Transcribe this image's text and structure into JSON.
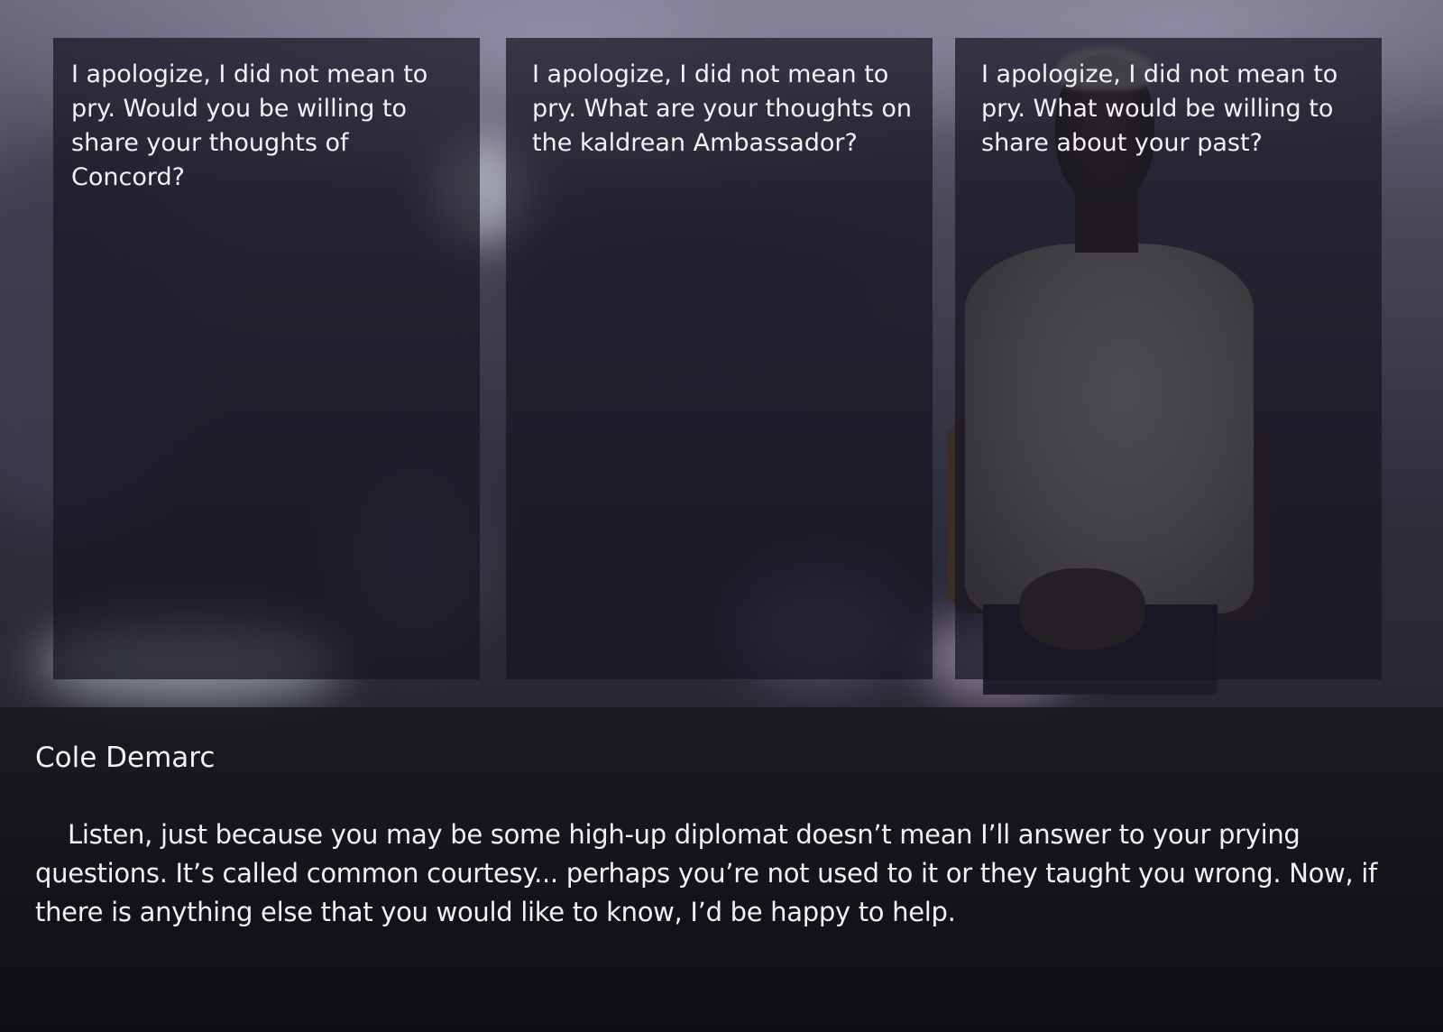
{
  "choices": [
    {
      "text": "I apologize, I did not mean to pry. Would you be willing to share your thoughts of Concord?"
    },
    {
      "text": "I apologize, I did not mean to pry. What are your thoughts on the kaldrean Ambassador?"
    },
    {
      "text": "I apologize, I did not mean to pry. What would be willing to share about your past?"
    }
  ],
  "dialogue": {
    "speaker": "Cole Demarc",
    "text": "Listen, just because you may be some high-up diplomat doesn’t mean I’ll answer to your prying questions. It’s called common courtesy... perhaps you’re not used to it or they taught you wrong. Now, if there is anything else that you would like to know, I’d be happy to help."
  }
}
